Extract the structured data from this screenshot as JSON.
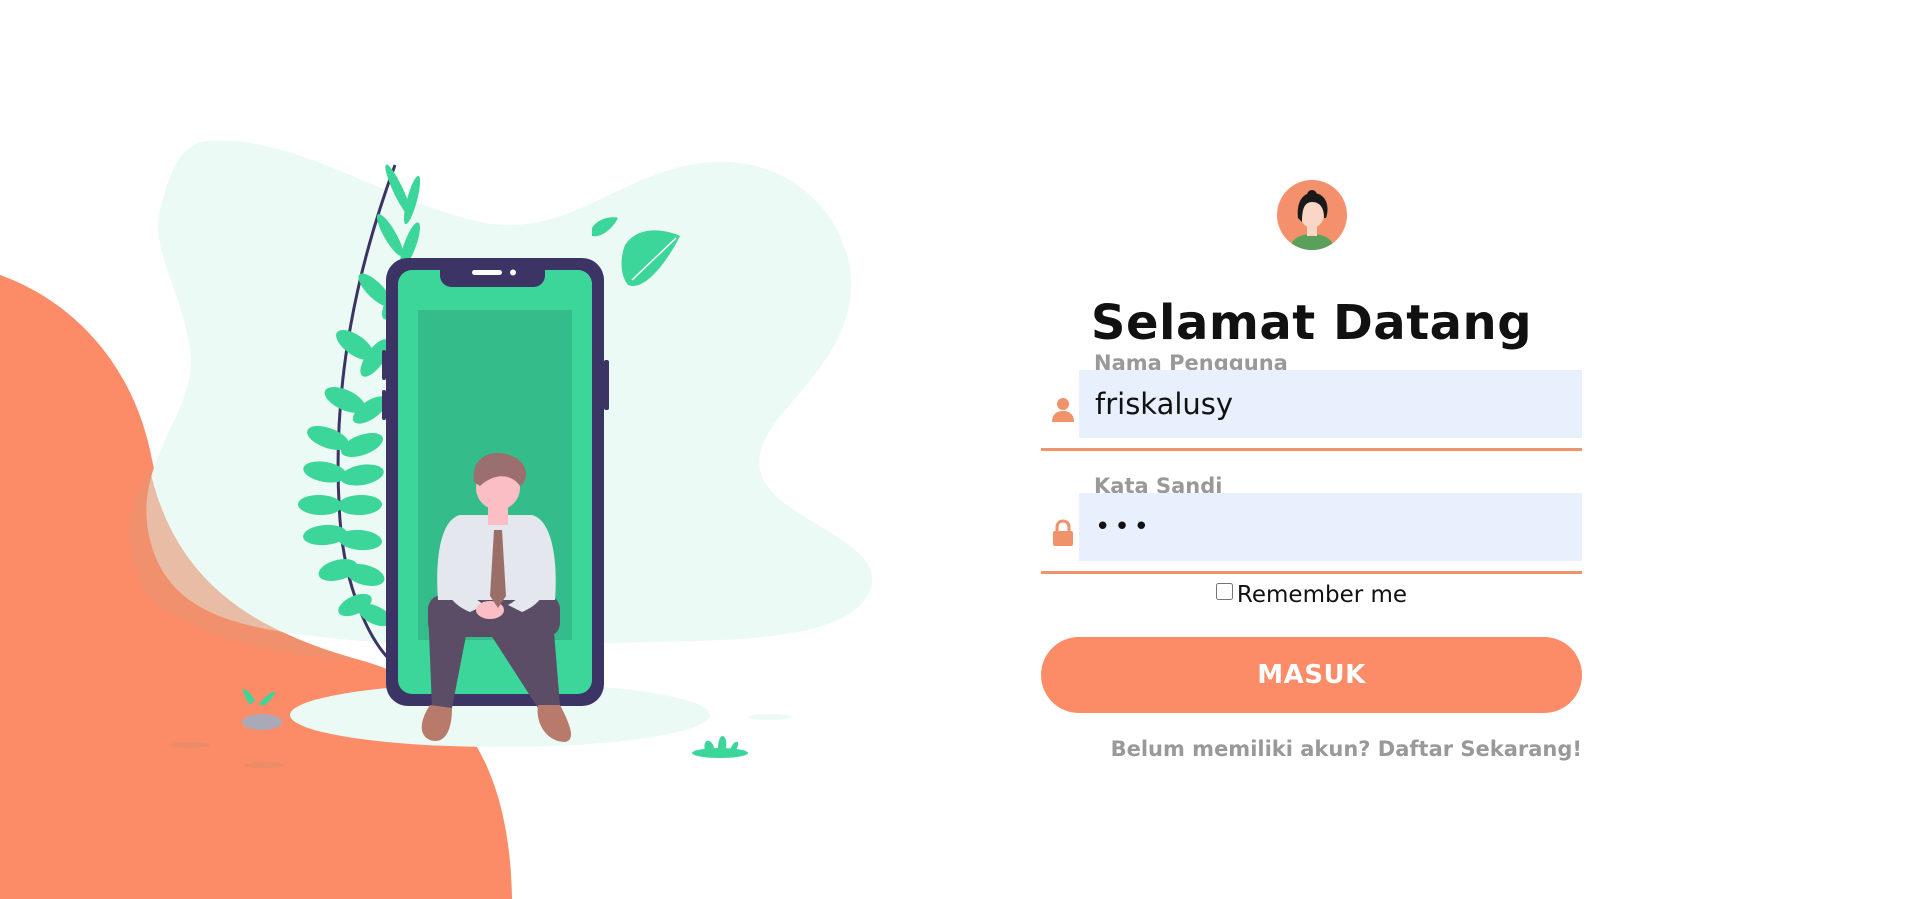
{
  "theme": {
    "accent": "#fc8b67",
    "input_background": "#e8f0fe",
    "illustration_green": "#3cd69b",
    "phone_frame": "#3b3465"
  },
  "login": {
    "avatar_icon": "user-avatar-icon",
    "title": "Selamat Datang",
    "username": {
      "label": "Nama Pengguna",
      "value": "friskalusy",
      "icon": "user-icon"
    },
    "password": {
      "label": "Kata Sandi",
      "value": "•••",
      "icon": "lock-icon"
    },
    "remember": {
      "label": "Remember me",
      "checked": false
    },
    "submit_label": "MASUK",
    "register_link": "Belum memiliki akun? Daftar Sekarang!"
  }
}
